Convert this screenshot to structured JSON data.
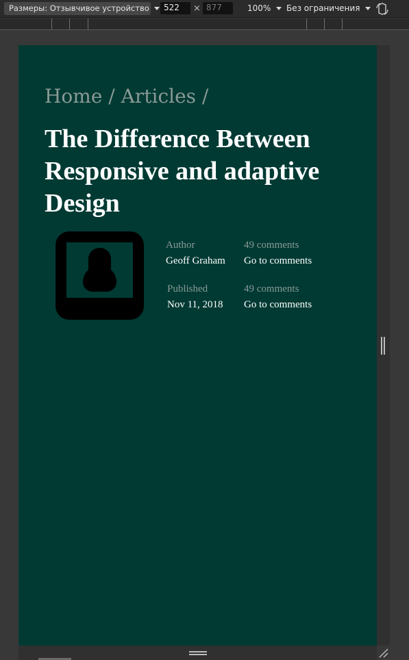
{
  "devtools": {
    "device_label": "Размеры: Отзывчивое устройство",
    "width_value": "522",
    "times_sign": "×",
    "height_value": "877",
    "zoom_label": "100%",
    "throttle_label": "Без ограничения",
    "icons": [
      "chevron-down-icon",
      "rotate-icon",
      "resize-grip-icon",
      "resize-corner-icon"
    ]
  },
  "page": {
    "background_color": "#003a33",
    "breadcrumb": "Home / Articles /",
    "title": "The Difference Between Responsive and adaptive Design",
    "avatar_icon": "user-portrait-icon",
    "meta": {
      "author_label": "Author",
      "author_name": "Geoff Graham",
      "comments_label_1": "49 comments",
      "comments_link_1": "Go to comments",
      "published_label": "Published",
      "published_date": "Nov 11, 2018",
      "comments_label_2": "49 comments",
      "comments_link_2": "Go to comments"
    }
  }
}
